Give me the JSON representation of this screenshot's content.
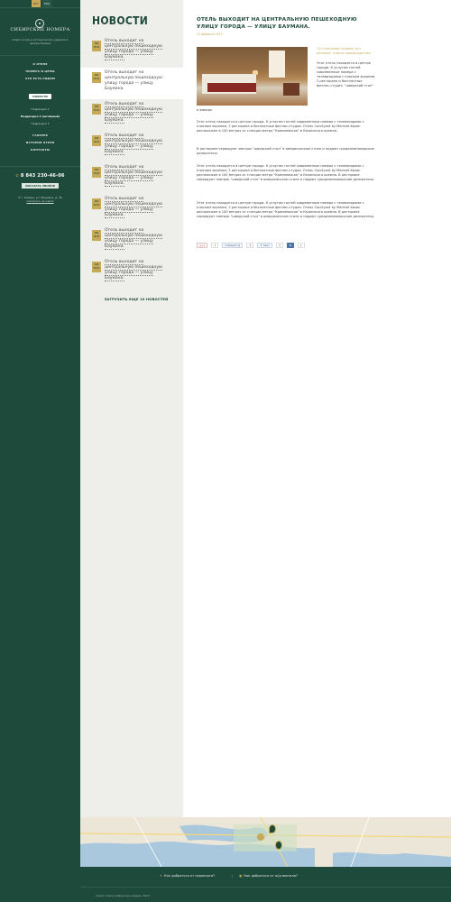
{
  "lang": {
    "active": "РУС",
    "other": "ENG"
  },
  "logo": {
    "title": "СИБИРСКИЕ НОМЕРА",
    "subtitle": "Апарт-отель в исторических зданиях в центре Казани"
  },
  "menu": {
    "items": [
      "О ОТЕЛЕ",
      "НОМЕРА И ЦЕНЫ",
      "ЧТО ЕСТЬ РЯДОМ",
      "НОВОСТИ"
    ],
    "subs": [
      "Подраздел 1",
      "Подраздел 2 (активный)",
      "Подраздел 3"
    ],
    "items2": [
      "ГАЛЕРЕЯ",
      "ИСТОРИЯ ОТЕЛЯ",
      "КОНТАКТЫ"
    ]
  },
  "contacts": {
    "phone": "8 843 230-46-06",
    "callback": "ЗАКАЗАТЬ ЗВОНОК",
    "address": "г. Казань, ул. Баумана, д. 36",
    "map_link": "Смотреть на карте"
  },
  "news_heading": "НОВОСТИ",
  "news": [
    {
      "day": "12",
      "month": "МАЯ",
      "text": "Отель выходит на центральную пешеходную улицу города — улицу Баумана."
    },
    {
      "day": "12",
      "month": "МАЯ",
      "text": "Отель выходит на центральную пешеходную улицу города — улицу Баумана."
    },
    {
      "day": "12",
      "month": "МАЯ",
      "text": "Отель выходит на центральную пешеходную улицу города — улицу Баумана."
    },
    {
      "day": "12",
      "month": "МАЯ",
      "text": "Отель выходит на центральную пешеходную улицу города — улицу Баумана."
    },
    {
      "day": "12",
      "month": "МАЯ",
      "text": "Отель выходит на центральную пешеходную улицу города — улицу Баумана."
    },
    {
      "day": "12",
      "month": "МАЯ",
      "text": "Отель выходит на центральную пешеходную улицу города — улицу Баумана."
    },
    {
      "day": "12",
      "month": "МАЯ",
      "text": "Отель выходит на центральную пешеходную улицу города — улицу Баумана."
    },
    {
      "day": "12",
      "month": "МАЯ",
      "text": "Отель выходит на центральную пешеходную улицу города — улицу Баумана."
    }
  ],
  "load_more": "ЗАГРУЗИТЬ ЕЩЕ 10 НОВОСТЕЙ",
  "article": {
    "title": "ОТЕЛЬ ВЫХОДИТ НА ЦЕНТРАЛЬНУЮ ПЕШЕХОДНУЮ УЛИЦУ ГОРОДА — УЛИЦУ БАУМАНА.",
    "date": "12 февраля 2013",
    "quote": "Тут описание номера, его великие, плюсы преимущества.",
    "intro": "Этот отель находится в центре города. К услугам гостей современные номера с телевизорами с плоским экраном, 2 ресторана и бесплатные фитнес-студия. \"шведский стол\"",
    "tail": "в америк",
    "p1": "Этот отель находится в центре города. К услугам гостей современные номера с телевизорами с плоским экраном, 2 ресторана и бесплатные фитнес-студия. Отель Courtyard by Marriott Kazan расположен в 100 метрах от станции метро \"Кремлевская\" и Казанского кремля.",
    "p2": "В ресторане сервируют завтрак \"шведский стол\" в американском стиле и подают средиземноморские деликатесы.",
    "p3": "Этот отель находится в центре города. К услугам гостей современные номера с телевизорами с плоским экраном, 2 ресторана и бесплатные фитнес-студия. Отель Courtyard by Marriott Kazan расположен в 100 метрах от станции метро \"Кремлевская\" и Казанского кремля. В ресторане сервируют завтрак \"шведский стол\" в американском стиле и подают средиземноморские деликатесы.",
    "p4": "Этот отель находится в центре города. К услугам гостей современные номера с телевизорами с плоским экраном, 2 ресторана и бесплатные фитнес-студия. Отель Courtyard by Marriott Kazan расположен в 100 метрах от станции метро \"Кремлевская\" и Казанского кремля. В ресторане сервируют завтрак \"шведский стол\" в американском стиле и подают средиземноморские деликатесы."
  },
  "social": {
    "g": "g+1",
    "g_count": "1",
    "fb": "Нравится",
    "fb_count": "3",
    "tw": "Твит",
    "tw_count": "4",
    "vk": "В",
    "vk_count": "1"
  },
  "footer": {
    "link1": "Как добраться от аэропорта?",
    "link2": "Как добраться от ж/д вокзала?",
    "copyright": "Апарт-отель Сибирские номера, 2013"
  }
}
